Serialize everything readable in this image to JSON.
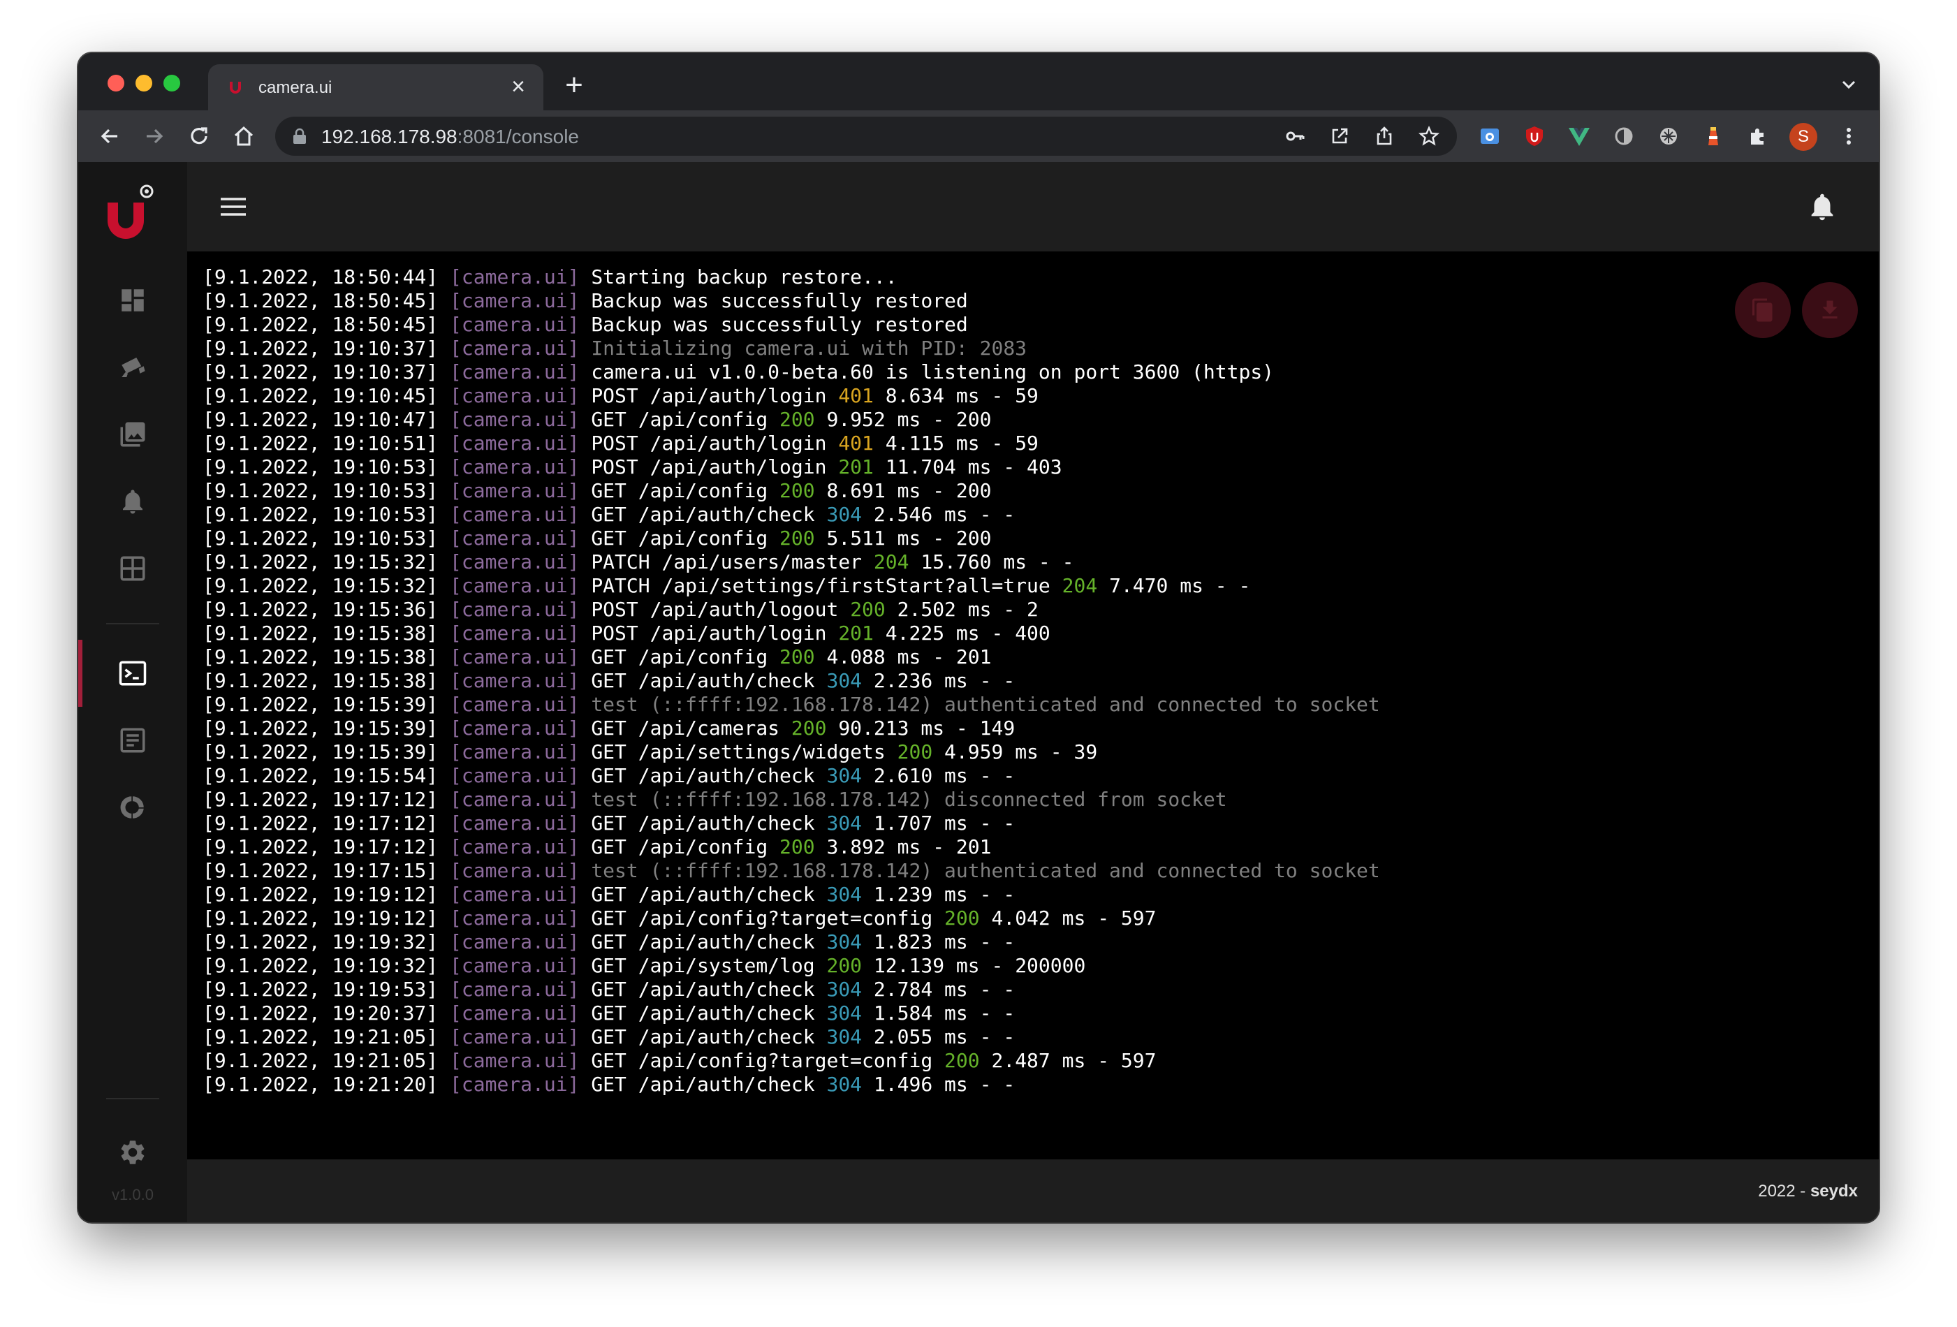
{
  "browser": {
    "tab_title": "camera.ui",
    "tab_close": "×",
    "new_tab": "+",
    "url_host": "192.168.178.98",
    "url_rest": ":8081/console",
    "profile_initial": "S"
  },
  "app": {
    "version": "v1.0.0",
    "footer_year": "2022 - ",
    "footer_author": "seydx",
    "accent_color": "#a21f3a"
  },
  "sidebar": {
    "items": [
      {
        "icon": "dashboard-icon"
      },
      {
        "icon": "cameras-icon"
      },
      {
        "icon": "recordings-icon"
      },
      {
        "icon": "notifications-icon"
      },
      {
        "icon": "camview-icon"
      },
      {
        "icon": "console-icon",
        "active": true
      },
      {
        "icon": "log-icon"
      },
      {
        "icon": "utilization-icon"
      },
      {
        "icon": "settings-icon"
      }
    ]
  },
  "console": {
    "lines": [
      {
        "ts": "[9.1.2022, 18:50:44]",
        "tag": "[camera.ui]",
        "method": "Starting backup restore...",
        "status": "",
        "rest": "",
        "dim": false
      },
      {
        "ts": "[9.1.2022, 18:50:45]",
        "tag": "[camera.ui]",
        "method": "Backup was successfully restored",
        "status": "",
        "rest": "",
        "dim": false
      },
      {
        "ts": "[9.1.2022, 18:50:45]",
        "tag": "[camera.ui]",
        "method": "Backup was successfully restored",
        "status": "",
        "rest": "",
        "dim": false
      },
      {
        "ts": "[9.1.2022, 19:10:37]",
        "tag": "[camera.ui]",
        "method": "Initializing camera.ui with PID: 2083",
        "status": "",
        "rest": "",
        "dim": true
      },
      {
        "ts": "[9.1.2022, 19:10:37]",
        "tag": "[camera.ui]",
        "method": "camera.ui v1.0.0-beta.60 is listening on port 3600 (https)",
        "status": "",
        "rest": "",
        "dim": false
      },
      {
        "ts": "[9.1.2022, 19:10:45]",
        "tag": "[camera.ui]",
        "method": "POST /api/auth/login",
        "status": "401",
        "rest": "8.634 ms - 59",
        "dim": false
      },
      {
        "ts": "[9.1.2022, 19:10:47]",
        "tag": "[camera.ui]",
        "method": "GET /api/config",
        "status": "200",
        "rest": "9.952 ms - 200",
        "dim": false
      },
      {
        "ts": "[9.1.2022, 19:10:51]",
        "tag": "[camera.ui]",
        "method": "POST /api/auth/login",
        "status": "401",
        "rest": "4.115 ms - 59",
        "dim": false
      },
      {
        "ts": "[9.1.2022, 19:10:53]",
        "tag": "[camera.ui]",
        "method": "POST /api/auth/login",
        "status": "201",
        "rest": "11.704 ms - 403",
        "dim": false
      },
      {
        "ts": "[9.1.2022, 19:10:53]",
        "tag": "[camera.ui]",
        "method": "GET /api/config",
        "status": "200",
        "rest": "8.691 ms - 200",
        "dim": false
      },
      {
        "ts": "[9.1.2022, 19:10:53]",
        "tag": "[camera.ui]",
        "method": "GET /api/auth/check",
        "status": "304",
        "rest": "2.546 ms - -",
        "dim": false
      },
      {
        "ts": "[9.1.2022, 19:10:53]",
        "tag": "[camera.ui]",
        "method": "GET /api/config",
        "status": "200",
        "rest": "5.511 ms - 200",
        "dim": false
      },
      {
        "ts": "[9.1.2022, 19:15:32]",
        "tag": "[camera.ui]",
        "method": "PATCH /api/users/master",
        "status": "204",
        "rest": "15.760 ms - -",
        "dim": false
      },
      {
        "ts": "[9.1.2022, 19:15:32]",
        "tag": "[camera.ui]",
        "method": "PATCH /api/settings/firstStart?all=true",
        "status": "204",
        "rest": "7.470 ms - -",
        "dim": false
      },
      {
        "ts": "[9.1.2022, 19:15:36]",
        "tag": "[camera.ui]",
        "method": "POST /api/auth/logout",
        "status": "200",
        "rest": "2.502 ms - 2",
        "dim": false
      },
      {
        "ts": "[9.1.2022, 19:15:38]",
        "tag": "[camera.ui]",
        "method": "POST /api/auth/login",
        "status": "201",
        "rest": "4.225 ms - 400",
        "dim": false
      },
      {
        "ts": "[9.1.2022, 19:15:38]",
        "tag": "[camera.ui]",
        "method": "GET /api/config",
        "status": "200",
        "rest": "4.088 ms - 201",
        "dim": false
      },
      {
        "ts": "[9.1.2022, 19:15:38]",
        "tag": "[camera.ui]",
        "method": "GET /api/auth/check",
        "status": "304",
        "rest": "2.236 ms - -",
        "dim": false
      },
      {
        "ts": "[9.1.2022, 19:15:39]",
        "tag": "[camera.ui]",
        "method": "test (::ffff:192.168.178.142) authenticated and connected to socket",
        "status": "",
        "rest": "",
        "dim": true
      },
      {
        "ts": "[9.1.2022, 19:15:39]",
        "tag": "[camera.ui]",
        "method": "GET /api/cameras",
        "status": "200",
        "rest": "90.213 ms - 149",
        "dim": false
      },
      {
        "ts": "[9.1.2022, 19:15:39]",
        "tag": "[camera.ui]",
        "method": "GET /api/settings/widgets",
        "status": "200",
        "rest": "4.959 ms - 39",
        "dim": false
      },
      {
        "ts": "[9.1.2022, 19:15:54]",
        "tag": "[camera.ui]",
        "method": "GET /api/auth/check",
        "status": "304",
        "rest": "2.610 ms - -",
        "dim": false
      },
      {
        "ts": "[9.1.2022, 19:17:12]",
        "tag": "[camera.ui]",
        "method": "test (::ffff:192.168.178.142) disconnected from socket",
        "status": "",
        "rest": "",
        "dim": true
      },
      {
        "ts": "[9.1.2022, 19:17:12]",
        "tag": "[camera.ui]",
        "method": "GET /api/auth/check",
        "status": "304",
        "rest": "1.707 ms - -",
        "dim": false
      },
      {
        "ts": "[9.1.2022, 19:17:12]",
        "tag": "[camera.ui]",
        "method": "GET /api/config",
        "status": "200",
        "rest": "3.892 ms - 201",
        "dim": false
      },
      {
        "ts": "[9.1.2022, 19:17:15]",
        "tag": "[camera.ui]",
        "method": "test (::ffff:192.168.178.142) authenticated and connected to socket",
        "status": "",
        "rest": "",
        "dim": true
      },
      {
        "ts": "[9.1.2022, 19:19:12]",
        "tag": "[camera.ui]",
        "method": "GET /api/auth/check",
        "status": "304",
        "rest": "1.239 ms - -",
        "dim": false
      },
      {
        "ts": "[9.1.2022, 19:19:12]",
        "tag": "[camera.ui]",
        "method": "GET /api/config?target=config",
        "status": "200",
        "rest": "4.042 ms - 597",
        "dim": false
      },
      {
        "ts": "[9.1.2022, 19:19:32]",
        "tag": "[camera.ui]",
        "method": "GET /api/auth/check",
        "status": "304",
        "rest": "1.823 ms - -",
        "dim": false
      },
      {
        "ts": "[9.1.2022, 19:19:32]",
        "tag": "[camera.ui]",
        "method": "GET /api/system/log",
        "status": "200",
        "rest": "12.139 ms - 200000",
        "dim": false
      },
      {
        "ts": "[9.1.2022, 19:19:53]",
        "tag": "[camera.ui]",
        "method": "GET /api/auth/check",
        "status": "304",
        "rest": "2.784 ms - -",
        "dim": false
      },
      {
        "ts": "[9.1.2022, 19:20:37]",
        "tag": "[camera.ui]",
        "method": "GET /api/auth/check",
        "status": "304",
        "rest": "1.584 ms - -",
        "dim": false
      },
      {
        "ts": "[9.1.2022, 19:21:05]",
        "tag": "[camera.ui]",
        "method": "GET /api/auth/check",
        "status": "304",
        "rest": "2.055 ms - -",
        "dim": false
      },
      {
        "ts": "[9.1.2022, 19:21:05]",
        "tag": "[camera.ui]",
        "method": "GET /api/config?target=config",
        "status": "200",
        "rest": "2.487 ms - 597",
        "dim": false
      },
      {
        "ts": "[9.1.2022, 19:21:20]",
        "tag": "[camera.ui]",
        "method": "GET /api/auth/check",
        "status": "304",
        "rest": "1.496 ms - -",
        "dim": false
      }
    ]
  }
}
